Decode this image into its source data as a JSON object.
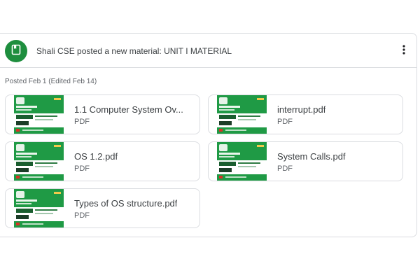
{
  "post": {
    "title": "Shali CSE posted a new material: UNIT I MATERIAL",
    "posted": "Posted Feb 1 (Edited Feb 14)",
    "avatar_icon": "book-icon",
    "menu_icon": "more-vert-icon"
  },
  "attachments": [
    {
      "name": "1.1 Computer System Ov...",
      "type": "PDF"
    },
    {
      "name": "interrupt.pdf",
      "type": "PDF"
    },
    {
      "name": "OS 1.2.pdf",
      "type": "PDF"
    },
    {
      "name": "System Calls.pdf",
      "type": "PDF"
    },
    {
      "name": "Types of OS structure.pdf",
      "type": "PDF"
    }
  ],
  "colors": {
    "accent": "#1e8e3e",
    "border": "#dadce0",
    "text": "#3c4043",
    "muted": "#5f6368"
  }
}
